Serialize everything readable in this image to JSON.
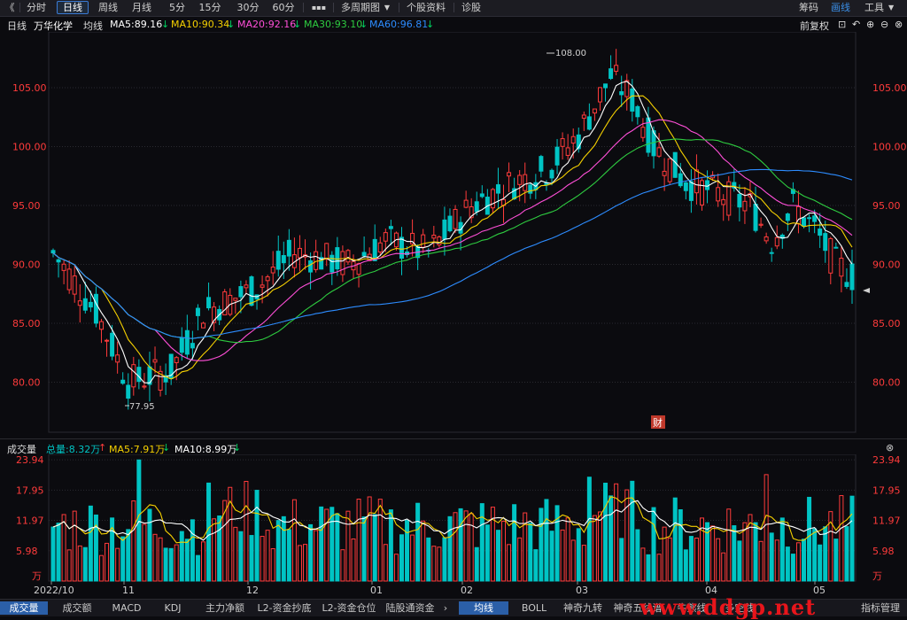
{
  "toolbar": {
    "back": "《",
    "tabs": [
      "分时",
      "日线",
      "周线",
      "月线",
      "5分",
      "15分",
      "30分",
      "60分"
    ],
    "more": "▪▪▪",
    "multi_period": "多周期图",
    "stock_info": "个股资料",
    "diagnose": "诊股",
    "chips": "筹码",
    "draw": "画线",
    "tools": "工具",
    "tools_arrow": "▼"
  },
  "ma_bar": {
    "period": "日线",
    "name": "万华化学",
    "avg_label": "均线",
    "ma5": "MA5:89.16",
    "ma10": "MA10:90.34",
    "ma20": "MA20:92.16",
    "ma30": "MA30:93.10",
    "ma60": "MA60:96.81",
    "adjust": "前复权"
  },
  "colors": {
    "up": "#ff3b3b",
    "down": "#00c4c4",
    "ma5": "#ffffff",
    "ma10": "#f5d000",
    "ma20": "#ff4fd8",
    "ma30": "#2ecc40",
    "ma60": "#2d8cff",
    "axis": "#ff3b3b",
    "grid": "#2a2a30"
  },
  "price_axis": [
    "105.00",
    "100.00",
    "95.00",
    "90.00",
    "85.00",
    "80.00"
  ],
  "annotations": {
    "high": "108.00",
    "low": "77.95",
    "finance_badge": "财"
  },
  "volume": {
    "title": "成交量",
    "total": "总量:8.32万",
    "ma5": "MA5:7.91万",
    "ma10": "MA10:8.99万",
    "axis": [
      "23.94",
      "17.95",
      "11.97",
      "5.98"
    ],
    "unit": "万"
  },
  "date_axis": [
    "2022/10",
    "11",
    "12",
    "01",
    "02",
    "03",
    "04",
    "05"
  ],
  "bottom_tabs": {
    "left": [
      "成交量",
      "成交额",
      "MACD",
      "KDJ",
      "主力净额",
      "L2-资金抄底",
      "L2-资金仓位",
      "陆股通资金"
    ],
    "right": [
      "均线",
      "BOLL",
      "神奇九转",
      "神奇五线谱",
      "牛熊线",
      "多空线",
      "指标管理"
    ],
    "watermark": "www.ddgp.net"
  }
}
